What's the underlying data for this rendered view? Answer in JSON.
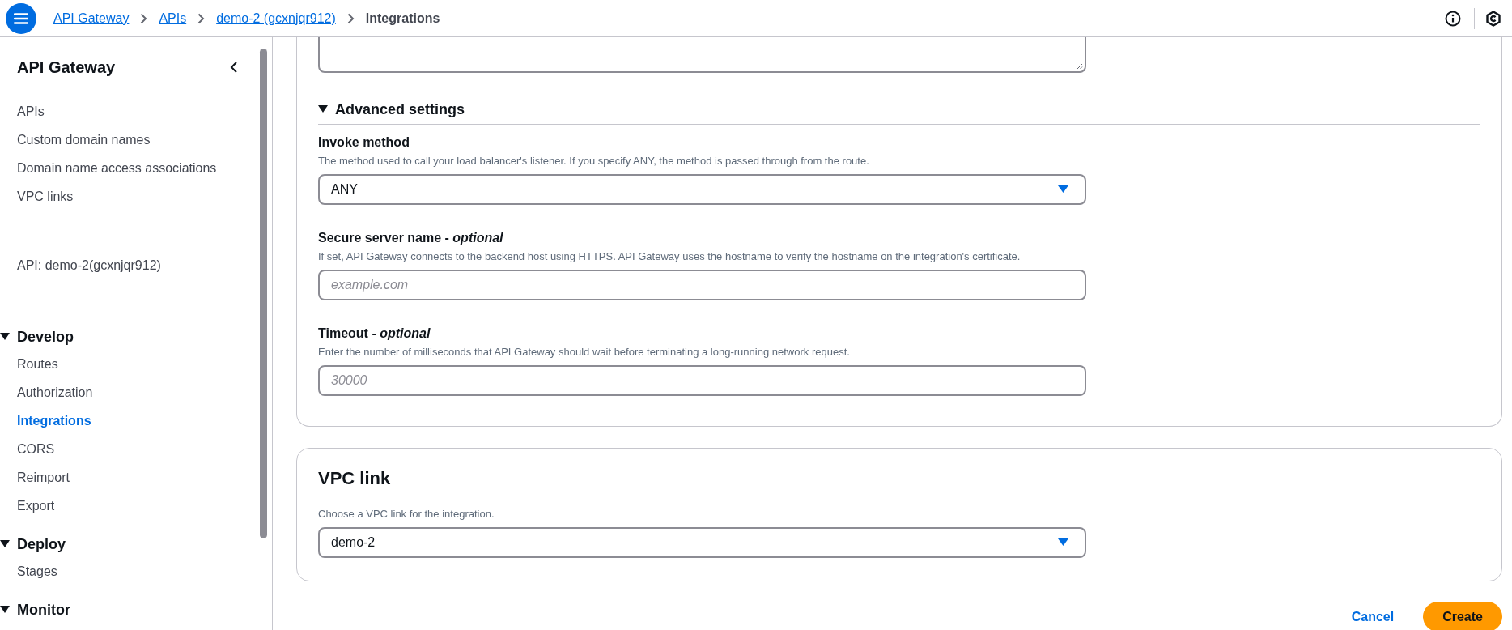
{
  "topbar": {
    "breadcrumbs": [
      {
        "label": "API Gateway",
        "kind": "link"
      },
      {
        "label": "APIs",
        "kind": "link"
      },
      {
        "label": "demo-2 (gcxnjqr912)",
        "kind": "link"
      },
      {
        "label": "Integrations",
        "kind": "current"
      }
    ]
  },
  "sidebar": {
    "title": "API Gateway",
    "items": [
      {
        "label": "APIs",
        "selected": false
      },
      {
        "label": "Custom domain names",
        "selected": false
      },
      {
        "label": "Domain name access associations",
        "selected": false
      },
      {
        "label": "VPC links",
        "selected": false
      }
    ],
    "api_label": "API: demo-2(gcxnjqr912)",
    "groups": [
      {
        "label": "Develop",
        "expanded": true,
        "items": [
          {
            "label": "Routes",
            "selected": false
          },
          {
            "label": "Authorization",
            "selected": false
          },
          {
            "label": "Integrations",
            "selected": true
          },
          {
            "label": "CORS",
            "selected": false
          },
          {
            "label": "Reimport",
            "selected": false
          },
          {
            "label": "Export",
            "selected": false
          }
        ]
      },
      {
        "label": "Deploy",
        "expanded": true,
        "items": [
          {
            "label": "Stages",
            "selected": false
          }
        ]
      },
      {
        "label": "Monitor",
        "expanded": true
      }
    ]
  },
  "advanced_settings": {
    "title": "Advanced settings",
    "expanded": true,
    "fields": [
      {
        "kind": "select",
        "label": "Invoke method",
        "description": "The method used to call your load balancer's listener. If you specify ANY, the method is passed through from the route.",
        "value": "ANY"
      },
      {
        "kind": "input",
        "label": "Secure server name - *optional*",
        "description": "If set, API Gateway connects to the backend host using HTTPS. API Gateway uses the hostname to verify the hostname on the integration's certificate.",
        "placeholder": "example.com"
      },
      {
        "kind": "input",
        "label": "Timeout - *optional*",
        "description": "Enter the number of milliseconds that API Gateway should wait before terminating a long-running network request.",
        "placeholder": "30000"
      }
    ]
  },
  "vpc_link": {
    "title": "VPC link",
    "fields": [
      {
        "kind": "select",
        "description": "Choose a VPC link for the integration.",
        "value": "demo-2"
      }
    ]
  },
  "actions": [
    {
      "label": "Cancel",
      "kind": "link"
    },
    {
      "label": "Create",
      "kind": "primary"
    }
  ]
}
